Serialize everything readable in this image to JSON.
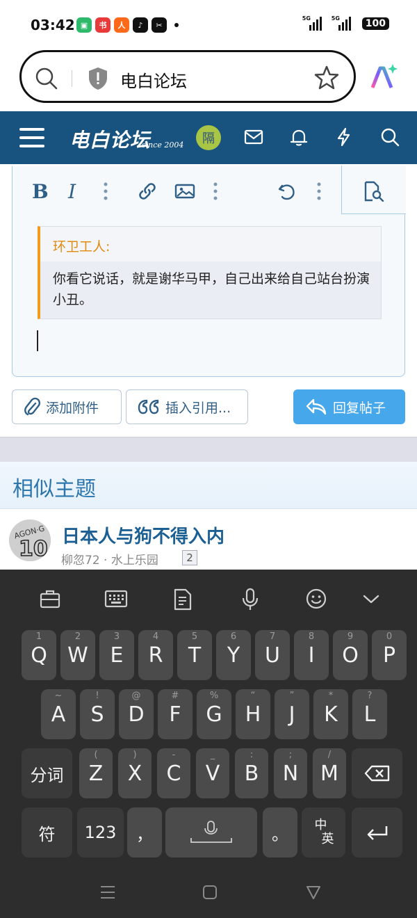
{
  "status_bar": {
    "time": "03:42",
    "apps": [
      {
        "name": "battery-app-icon",
        "color": "#2fb96b",
        "glyph": "▣"
      },
      {
        "name": "xiaohongshu-icon",
        "color": "#e93a3a",
        "glyph": "书"
      },
      {
        "name": "taobao-icon",
        "color": "#ff6a1a",
        "glyph": "人"
      },
      {
        "name": "tiktok-icon",
        "color": "#111111",
        "glyph": "♪"
      },
      {
        "name": "capcut-icon",
        "color": "#111111",
        "glyph": "✂"
      }
    ],
    "signal1": "5G",
    "signal2": "5G",
    "battery": "100"
  },
  "address_bar": {
    "text": "电白论坛"
  },
  "site_header": {
    "logo": "电白论坛",
    "since": "since 2004",
    "user_badge": "隔",
    "bg_color": "#18537f"
  },
  "editor": {
    "toolbar": {
      "bold": "B",
      "italic": "I"
    },
    "quote": {
      "author": "环卫工人:",
      "text": "你看它说话，就是谢华马甲，自己出来给自己站台扮演小丑。"
    }
  },
  "buttons": {
    "attach": "添加附件",
    "insert_quote": "插入引用...",
    "reply": "回复帖子"
  },
  "similar": {
    "heading": "相似主题",
    "threads": [
      {
        "title": "日本人与狗不得入内",
        "meta": "柳忽72 · 水上乐园",
        "replies": "2"
      }
    ]
  },
  "keyboard": {
    "row1": [
      {
        "k": "Q",
        "h": "1"
      },
      {
        "k": "W",
        "h": "2"
      },
      {
        "k": "E",
        "h": "3"
      },
      {
        "k": "R",
        "h": "4"
      },
      {
        "k": "T",
        "h": "5"
      },
      {
        "k": "Y",
        "h": "6"
      },
      {
        "k": "U",
        "h": "7"
      },
      {
        "k": "I",
        "h": "8"
      },
      {
        "k": "O",
        "h": "9"
      },
      {
        "k": "P",
        "h": "0"
      }
    ],
    "row2": [
      {
        "k": "A",
        "h": "~"
      },
      {
        "k": "S",
        "h": "!"
      },
      {
        "k": "D",
        "h": "@"
      },
      {
        "k": "F",
        "h": "#"
      },
      {
        "k": "G",
        "h": "%"
      },
      {
        "k": "H",
        "h": "“"
      },
      {
        "k": "J",
        "h": "”"
      },
      {
        "k": "K",
        "h": "*"
      },
      {
        "k": "L",
        "h": "?"
      }
    ],
    "row3": [
      {
        "k": "Z",
        "h": "("
      },
      {
        "k": "X",
        "h": ")"
      },
      {
        "k": "C",
        "h": "-"
      },
      {
        "k": "V",
        "h": "_"
      },
      {
        "k": "B",
        "h": ":"
      },
      {
        "k": "N",
        "h": ";"
      },
      {
        "k": "M",
        "h": "/"
      }
    ],
    "fenci": "分词",
    "fu": "符",
    "num": "123",
    "comma": "，",
    "period": "。",
    "lang_top": "中",
    "lang_bottom": "英"
  }
}
